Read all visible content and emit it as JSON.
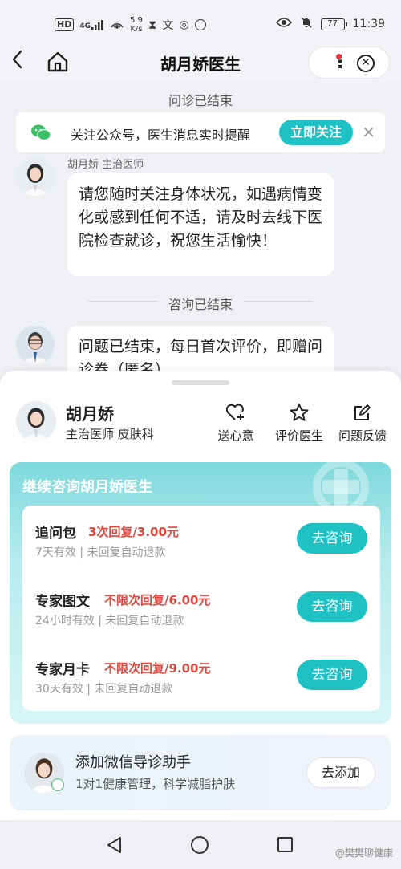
{
  "status_bar": {
    "hd": "HD",
    "signal": "4G",
    "speed_value": "5.9",
    "speed_unit": "K/s",
    "battery": "77",
    "time": "11:39"
  },
  "nav": {
    "title": "胡月娇医生"
  },
  "chat": {
    "divider_1": "问诊已结束",
    "follow_banner": {
      "text": "关注公众号，医生消息实时提醒",
      "button": "立即关注",
      "close": "×"
    },
    "sender": "胡月娇 主治医师",
    "message_1": "请您随时关注身体状况，如遇病情变化或感到任何不适，请及时去线下医院检查就诊，祝您生活愉快！",
    "divider_2": "咨询已结束",
    "message_2": "问题已结束，每日首次评价，即赠问诊券（匿名）"
  },
  "sheet": {
    "doctor_name": "胡月娇",
    "doctor_title": "主治医师  皮肤科",
    "actions": [
      {
        "label": "送心意",
        "icon": "heart-plus-icon"
      },
      {
        "label": "评价医生",
        "icon": "star-icon"
      },
      {
        "label": "问题反馈",
        "icon": "edit-icon"
      }
    ],
    "consult_title": "继续咨询胡月娇医生",
    "packages": [
      {
        "name": "追问包",
        "price": "3次回复/3.00元",
        "note": "7天有效 | 未回复自动退款",
        "button": "去咨询"
      },
      {
        "name": "专家图文",
        "price": "不限次回复/6.00元",
        "note": "24小时有效 | 未回复自动退款",
        "button": "去咨询"
      },
      {
        "name": "专家月卡",
        "price": "不限次回复/9.00元",
        "note": "30天有效 | 未回复自动退款",
        "button": "去咨询"
      }
    ],
    "wechat_card": {
      "title": "添加微信导诊助手",
      "subtitle": "1对1健康管理，科学减脂护肤",
      "button": "去添加"
    }
  },
  "watermark": "@樊樊聊健康",
  "colors": {
    "accent": "#1ec2c4",
    "price_red": "#e2453c",
    "wechat_green": "#3bbf66"
  }
}
